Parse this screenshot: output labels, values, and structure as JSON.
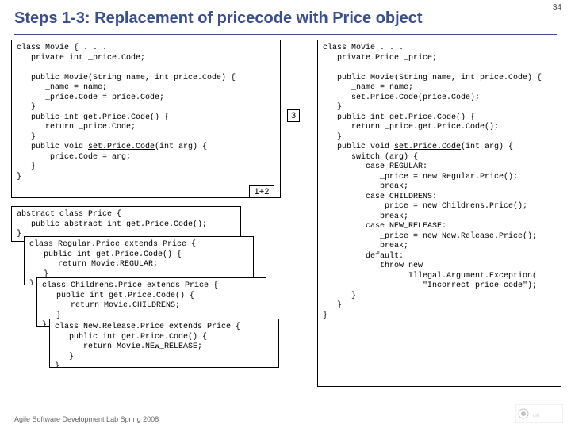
{
  "page_number": "34",
  "title": "Steps 1-3: Replacement of pricecode with Price object",
  "left_top_code": "class Movie { . . .\n   private int _price.Code;\n\n   public Movie(String name, int price.Code) {\n      _name = name;\n      _price.Code = price.Code;\n   }\n   public int get.Price.Code() {\n      return _price.Code;\n   }\n   public void <u>set.Price.Code</u>(int arg) {\n      _price.Code = arg;\n   }\n}",
  "right_code": "class Movie . . .\n   private Price _price;\n\n   public Movie(String name, int price.Code) {\n      _name = name;\n      set.Price.Code(price.Code);\n   }\n   public int get.Price.Code() {\n      return _price.get.Price.Code();\n   }\n   public void <u>set.Price.Code</u>(int arg) {\n      switch (arg) {\n         case REGULAR:\n            _price = new Regular.Price();\n            break;\n         case CHILDRENS:\n            _price = new Childrens.Price();\n            break;\n         case NEW_RELEASE:\n            _price = new New.Release.Price();\n            break;\n         default:\n            throw new\n                  Illegal.Argument.Exception(\n                     \"Incorrect price code\");\n      }\n   }\n}",
  "abs1": "abstract class Price {\n   public abstract int get.Price.Code();\n}",
  "abs2": "class Regular.Price extends Price {\n   public int get.Price.Code() {\n      return Movie.REGULAR;\n   }\n}",
  "abs3": "class Childrens.Price extends Price {\n   public int get.Price.Code() {\n      return Movie.CHILDRENS;\n   }\n}",
  "abs4": "class New.Release.Price extends Price {\n   public int get.Price.Code() {\n      return Movie.NEW_RELEASE;\n   }\n}",
  "badge_3": "3",
  "badge_12": "1+2",
  "footer": "Agile Software Development Lab Spring 2008"
}
